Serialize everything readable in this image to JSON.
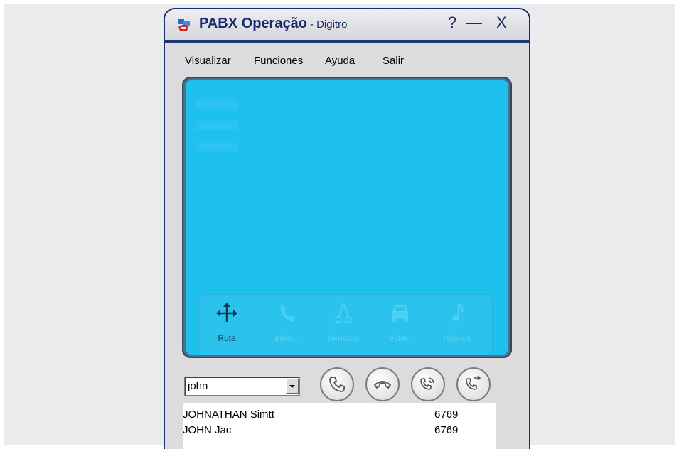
{
  "window": {
    "title": "PABX Operação",
    "subtitle": "- Digitro",
    "help_label": "?",
    "minimize_label": "—",
    "close_label": "X"
  },
  "menu": [
    {
      "underline": "V",
      "rest": "isualizar"
    },
    {
      "underline": "F",
      "rest": "unciones"
    },
    {
      "pre": "Ay",
      "underline": "u",
      "rest": "da"
    },
    {
      "underline": "S",
      "rest": "alir"
    }
  ],
  "functions": [
    {
      "label": "Ruta",
      "icon": "route-arrows-icon",
      "enabled": true
    },
    {
      "label": "interc.",
      "icon": "intercept-phone-icon",
      "enabled": false
    },
    {
      "label": "péndulo",
      "icon": "pendulum-icon",
      "enabled": false
    },
    {
      "label": "estac.",
      "icon": "car-icon",
      "enabled": false
    },
    {
      "label": "música",
      "icon": "music-note-icon",
      "enabled": false
    }
  ],
  "search": {
    "value": "john"
  },
  "call_buttons": [
    {
      "name": "answer-button",
      "icon": "phone-handset-icon"
    },
    {
      "name": "hangup-button",
      "icon": "hangup-handset-icon"
    },
    {
      "name": "ring-button",
      "icon": "ringing-phone-icon"
    },
    {
      "name": "transfer-button",
      "icon": "transfer-phone-icon"
    }
  ],
  "results": [
    {
      "name": "JOHNATHAN Simtt",
      "ext": "6769"
    },
    {
      "name": "JOHN Jac",
      "ext": "6769"
    }
  ],
  "colors": {
    "screen": "#1ec0ee",
    "frame_border": "#172f72",
    "title_text": "#1a2a6a"
  }
}
